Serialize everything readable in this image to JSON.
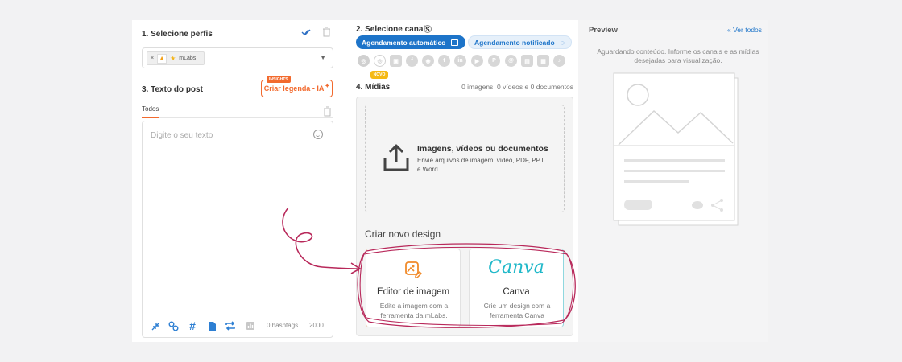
{
  "profiles": {
    "title": "1. Selecione perfis",
    "chip_remove": "×",
    "chip_label": "mLabs"
  },
  "post_text": {
    "title": "3. Texto do post",
    "insights_badge": "INSIGHTS",
    "ai_button": "Criar legenda - IA",
    "tab": "Todos",
    "placeholder": "Digite o seu texto",
    "hashtags": "0 hashtags",
    "char_count": "2000"
  },
  "channels": {
    "title": "2. Selecione canais",
    "auto_label": "Agendamento automático",
    "notif_label": "Agendamento notificado",
    "novo_badge": "NOVO",
    "icons": [
      "instagram-icon",
      "instagram-story-icon",
      "instagram-reels-icon",
      "facebook-icon",
      "messenger-icon",
      "twitter-icon",
      "linkedin-icon",
      "youtube-icon",
      "pinterest-icon",
      "threads-icon",
      "google-business-icon",
      "gallery-icon",
      "tiktok-icon"
    ]
  },
  "media": {
    "title": "4. Mídias",
    "count": "0 imagens, 0 vídeos e 0 documentos",
    "upload_title": "Imagens, vídeos ou documentos",
    "upload_desc": "Envie arquivos de imagem, vídeo, PDF, PPT e Word",
    "design_title": "Criar novo design",
    "editor_title": "Editor de imagem",
    "editor_desc": "Edite a imagem com a ferramenta da mLabs.",
    "canva_logo": "Canva",
    "canva_title": "Canva",
    "canva_desc": "Crie um design com a ferramenta Canva"
  },
  "preview": {
    "title": "Preview",
    "ver_todos": "Ver todos",
    "waiting": "Aguardando conteúdo. Informe os canais e as mídias desejadas para visualização."
  },
  "colors": {
    "accent_orange": "#f26a2e",
    "accent_blue": "#1d74c9",
    "canva_teal": "#20b8c9",
    "annotation": "#b8285a"
  }
}
